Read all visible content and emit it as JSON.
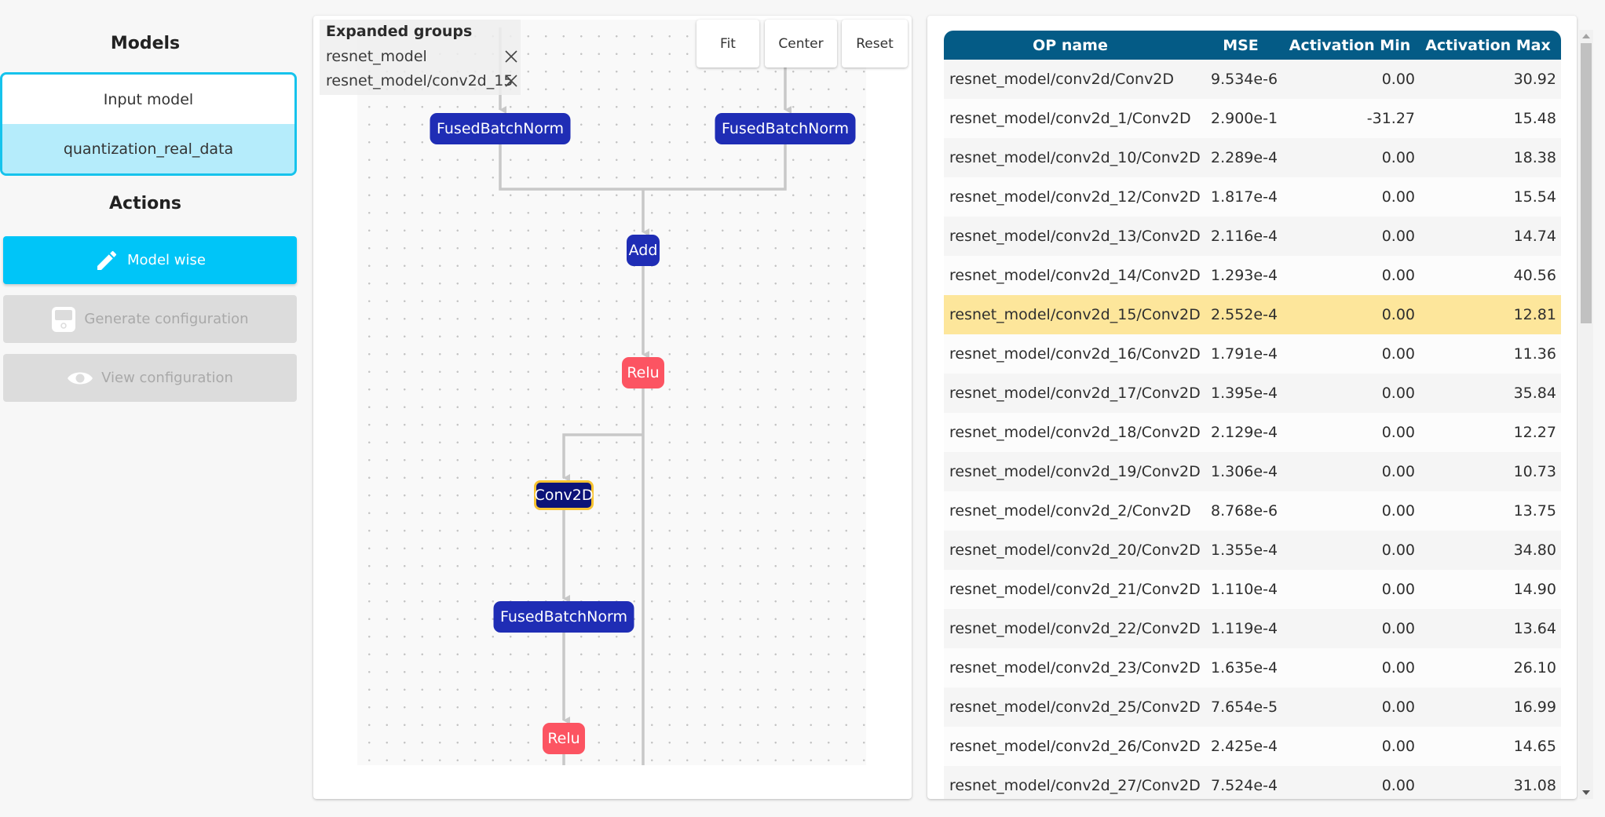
{
  "sidebar": {
    "models_title": "Models",
    "models": [
      {
        "label": "Input model",
        "selected": false
      },
      {
        "label": "quantization_real_data",
        "selected": true
      }
    ],
    "actions_title": "Actions",
    "actions": [
      {
        "label": "Model wise",
        "icon": "pencil-icon",
        "state": "enabled"
      },
      {
        "label": "Generate configuration",
        "icon": "save-icon",
        "state": "disabled"
      },
      {
        "label": "View configuration",
        "icon": "eye-icon",
        "state": "disabled"
      }
    ]
  },
  "graph": {
    "expanded_groups": {
      "title": "Expanded groups",
      "items": [
        "resnet_model",
        "resnet_model/conv2d_15"
      ],
      "remove_icon": "close-icon"
    },
    "controls": {
      "fit": "Fit",
      "center": "Center",
      "reset": "Reset"
    },
    "nodes": [
      {
        "id": "fbn_left",
        "label": "FusedBatchNorm",
        "kind": "op"
      },
      {
        "id": "fbn_right",
        "label": "FusedBatchNorm",
        "kind": "op"
      },
      {
        "id": "add",
        "label": "Add",
        "kind": "op"
      },
      {
        "id": "relu_1",
        "label": "Relu",
        "kind": "activation"
      },
      {
        "id": "conv2d",
        "label": "Conv2D",
        "kind": "op",
        "selected": true
      },
      {
        "id": "fbn_bottom",
        "label": "FusedBatchNorm",
        "kind": "op"
      },
      {
        "id": "relu_2",
        "label": "Relu",
        "kind": "activation"
      }
    ],
    "edges": [
      [
        "fbn_left",
        "add"
      ],
      [
        "fbn_right",
        "add"
      ],
      [
        "add",
        "relu_1"
      ],
      [
        "relu_1",
        "conv2d"
      ],
      [
        "conv2d",
        "fbn_bottom"
      ],
      [
        "fbn_bottom",
        "relu_2"
      ]
    ],
    "colors": {
      "op": "#1f2db5",
      "activation": "#fc5462",
      "selected_fill": "#0b1378",
      "selected_border": "#f7c331",
      "edge": "#c8c8c8"
    }
  },
  "table": {
    "columns": [
      "OP name",
      "MSE",
      "Activation Min",
      "Activation Max"
    ],
    "highlighted_row": "resnet_model/conv2d_15/Conv2D",
    "rows": [
      {
        "name": "resnet_model/conv2d/Conv2D",
        "mse": "9.534e-6",
        "min": "0.00",
        "max": "30.92"
      },
      {
        "name": "resnet_model/conv2d_1/Conv2D",
        "mse": "2.900e-1",
        "min": "-31.27",
        "max": "15.48"
      },
      {
        "name": "resnet_model/conv2d_10/Conv2D",
        "mse": "2.289e-4",
        "min": "0.00",
        "max": "18.38"
      },
      {
        "name": "resnet_model/conv2d_12/Conv2D",
        "mse": "1.817e-4",
        "min": "0.00",
        "max": "15.54"
      },
      {
        "name": "resnet_model/conv2d_13/Conv2D",
        "mse": "2.116e-4",
        "min": "0.00",
        "max": "14.74"
      },
      {
        "name": "resnet_model/conv2d_14/Conv2D",
        "mse": "1.293e-4",
        "min": "0.00",
        "max": "40.56"
      },
      {
        "name": "resnet_model/conv2d_15/Conv2D",
        "mse": "2.552e-4",
        "min": "0.00",
        "max": "12.81"
      },
      {
        "name": "resnet_model/conv2d_16/Conv2D",
        "mse": "1.791e-4",
        "min": "0.00",
        "max": "11.36"
      },
      {
        "name": "resnet_model/conv2d_17/Conv2D",
        "mse": "1.395e-4",
        "min": "0.00",
        "max": "35.84"
      },
      {
        "name": "resnet_model/conv2d_18/Conv2D",
        "mse": "2.129e-4",
        "min": "0.00",
        "max": "12.27"
      },
      {
        "name": "resnet_model/conv2d_19/Conv2D",
        "mse": "1.306e-4",
        "min": "0.00",
        "max": "10.73"
      },
      {
        "name": "resnet_model/conv2d_2/Conv2D",
        "mse": "8.768e-6",
        "min": "0.00",
        "max": "13.75"
      },
      {
        "name": "resnet_model/conv2d_20/Conv2D",
        "mse": "1.355e-4",
        "min": "0.00",
        "max": "34.80"
      },
      {
        "name": "resnet_model/conv2d_21/Conv2D",
        "mse": "1.110e-4",
        "min": "0.00",
        "max": "14.90"
      },
      {
        "name": "resnet_model/conv2d_22/Conv2D",
        "mse": "1.119e-4",
        "min": "0.00",
        "max": "13.64"
      },
      {
        "name": "resnet_model/conv2d_23/Conv2D",
        "mse": "1.635e-4",
        "min": "0.00",
        "max": "26.10"
      },
      {
        "name": "resnet_model/conv2d_25/Conv2D",
        "mse": "7.654e-5",
        "min": "0.00",
        "max": "16.99"
      },
      {
        "name": "resnet_model/conv2d_26/Conv2D",
        "mse": "2.425e-4",
        "min": "0.00",
        "max": "14.65"
      },
      {
        "name": "resnet_model/conv2d_27/Conv2D",
        "mse": "7.524e-4",
        "min": "0.00",
        "max": "31.08"
      }
    ]
  },
  "colors": {
    "accent": "#00c5f8",
    "selected_model_bg": "#b5ecfb",
    "table_header": "#045b86",
    "row_highlight": "#fde69b"
  }
}
